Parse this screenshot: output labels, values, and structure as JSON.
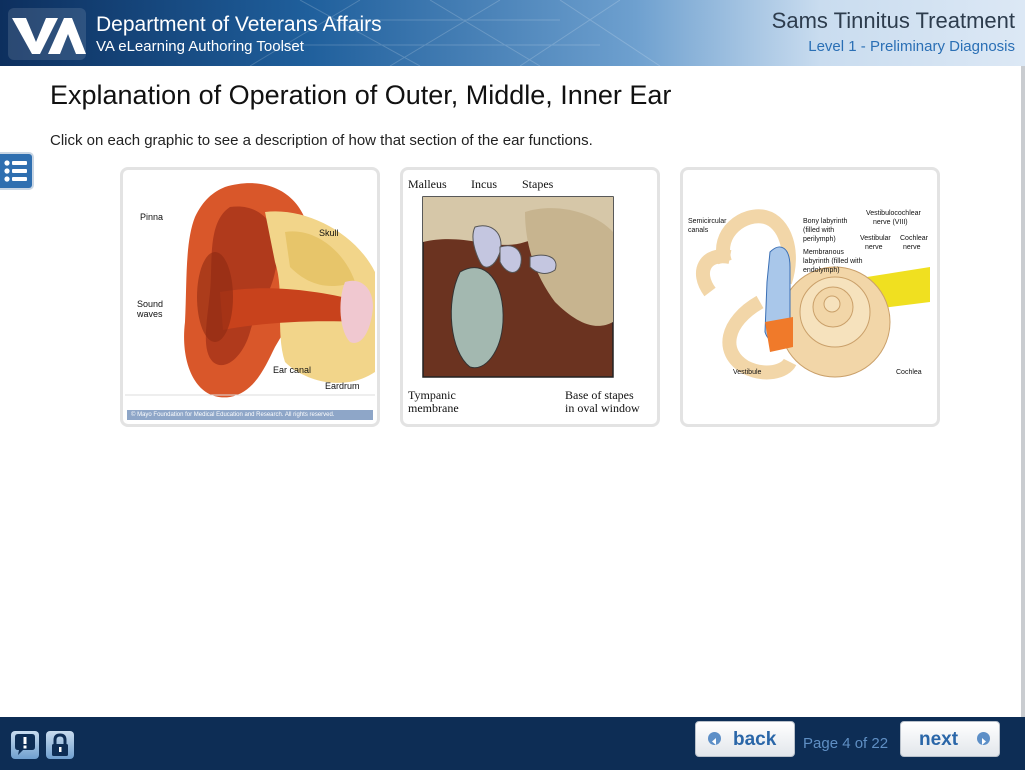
{
  "header": {
    "department": "Department of Veterans Affairs",
    "toolset": "VA eLearning Authoring Toolset",
    "course_title": "Sams Tinnitus Treatment",
    "level": "Level 1 - Preliminary Diagnosis",
    "logo_text": "VA"
  },
  "main": {
    "title": "Explanation of Operation of Outer, Middle, Inner Ear",
    "instructions": "Click on each graphic to see a description of how that section of the ear functions."
  },
  "sidebar": {
    "menu_icon": "list-icon"
  },
  "cards": {
    "outer": {
      "labels": {
        "pinna": "Pinna",
        "skull": "Skull",
        "sound_waves_1": "Sound",
        "sound_waves_2": "waves",
        "ear_canal": "Ear canal",
        "eardrum": "Eardrum"
      },
      "credit": "© Mayo Foundation for Medical Education and Research. All rights reserved."
    },
    "middle": {
      "labels": {
        "malleus": "Malleus",
        "incus": "Incus",
        "stapes": "Stapes",
        "tympanic_1": "Tympanic",
        "tympanic_2": "membrane",
        "base_1": "Base of stapes",
        "base_2": "in oval window"
      }
    },
    "inner": {
      "labels": {
        "semicircular_1": "Semicircular",
        "semicircular_2": "canals",
        "bony_1": "Bony labyrinth",
        "bony_2": "(filled with",
        "bony_3": "perilymph)",
        "membranous_1": "Membranous",
        "membranous_2": "labyrinth (filled with",
        "membranous_3": "endolymph)",
        "vestibulocochlear_1": "Vestibulocochlear",
        "vestibulocochlear_2": "nerve (VIII)",
        "vestibular_1": "Vestibular",
        "vestibular_2": "nerve",
        "cochlear_1": "Cochlear",
        "cochlear_2": "nerve",
        "vestibule": "Vestibule",
        "cochlea": "Cochlea"
      }
    }
  },
  "footer": {
    "help_icon": "help-icon",
    "lock_icon": "lock-icon",
    "back_label": "back",
    "next_label": "next",
    "page_indicator": "Page 4 of 22"
  }
}
